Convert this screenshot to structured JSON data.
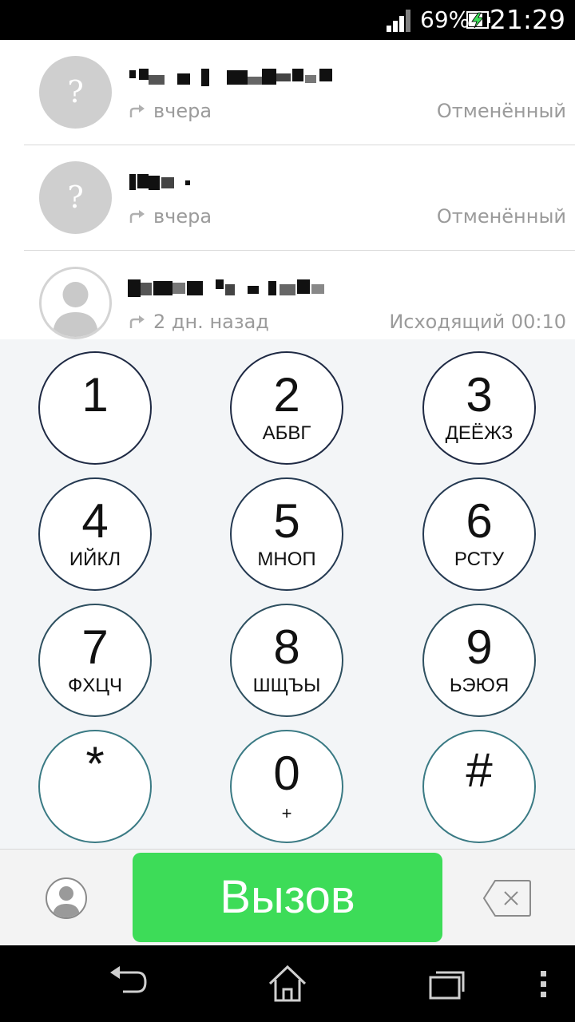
{
  "status_bar": {
    "battery_percent": "69%",
    "time": "21:29",
    "icons": [
      "signal-icon",
      "battery-charging-icon"
    ]
  },
  "call_log": [
    {
      "avatar": "?",
      "when": "вчера",
      "status": "Отменённый",
      "direction": "outgoing"
    },
    {
      "avatar": "?",
      "when": "вчера",
      "status": "Отменённый",
      "direction": "outgoing"
    },
    {
      "avatar": "",
      "when": "2 дн. назад",
      "status": "Исходящий 00:10",
      "direction": "outgoing"
    }
  ],
  "keypad": [
    {
      "digit": "1",
      "letters": ""
    },
    {
      "digit": "2",
      "letters": "АБВГ"
    },
    {
      "digit": "3",
      "letters": "ДЕЁЖЗ"
    },
    {
      "digit": "4",
      "letters": "ИЙКЛ"
    },
    {
      "digit": "5",
      "letters": "МНОП"
    },
    {
      "digit": "6",
      "letters": "РСТУ"
    },
    {
      "digit": "7",
      "letters": "ФХЦЧ"
    },
    {
      "digit": "8",
      "letters": "ШЩЪЫ"
    },
    {
      "digit": "9",
      "letters": "ЬЭЮЯ"
    },
    {
      "digit": "*",
      "letters": ""
    },
    {
      "digit": "0",
      "letters": "+"
    },
    {
      "digit": "#",
      "letters": ""
    }
  ],
  "actions": {
    "call_label": "Вызов",
    "call_color": "#3ddc58"
  },
  "nav_bar": {
    "icons": [
      "back-icon",
      "home-icon",
      "recent-apps-icon",
      "overflow-menu-icon"
    ]
  }
}
